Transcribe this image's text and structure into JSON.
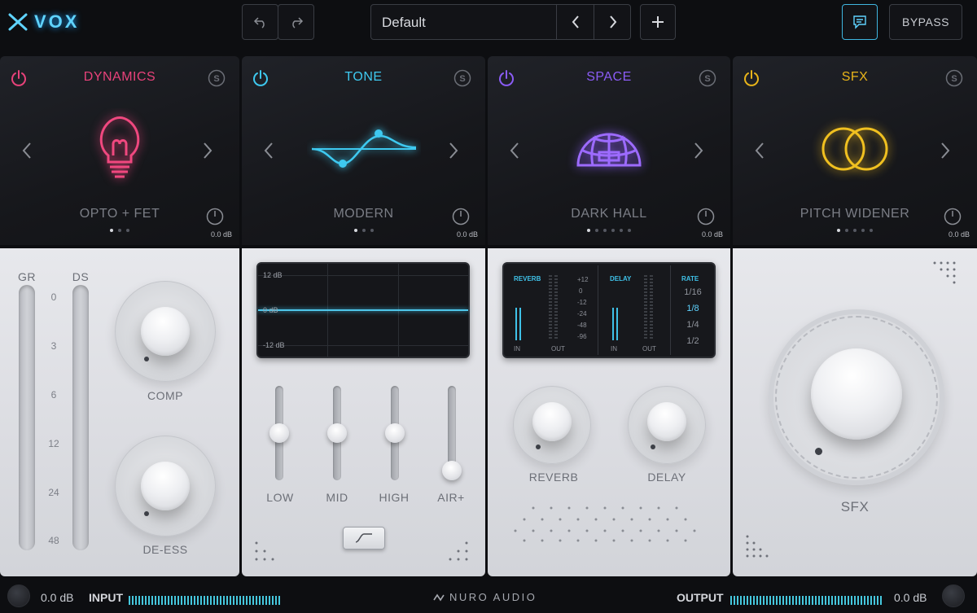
{
  "app": {
    "logo": "VOX",
    "brand": "NURO AUDIO"
  },
  "toolbar": {
    "undo_icon": "undo-icon",
    "redo_icon": "redo-icon",
    "preset_name": "Default",
    "add_icon": "plus-icon",
    "chat_icon": "chat-icon",
    "bypass_label": "BYPASS"
  },
  "modules": [
    {
      "title": "DYNAMICS",
      "color": "#e8427a",
      "preset": "OPTO + FET",
      "gain": "0.0 dB",
      "icon": "lightbulb-icon"
    },
    {
      "title": "TONE",
      "color": "#3ec9f0",
      "preset": "MODERN",
      "gain": "0.0 dB",
      "icon": "eq-curve-icon"
    },
    {
      "title": "SPACE",
      "color": "#8b5cf6",
      "preset": "DARK HALL",
      "gain": "0.0 dB",
      "icon": "dome-icon"
    },
    {
      "title": "SFX",
      "color": "#e8b41a",
      "preset": "PITCH WIDENER",
      "gain": "0.0 dB",
      "icon": "rings-icon"
    }
  ],
  "dynamics": {
    "gr_label": "GR",
    "ds_label": "DS",
    "scale": [
      "0",
      "3",
      "6",
      "12",
      "24",
      "48"
    ],
    "comp_label": "COMP",
    "deess_label": "DE-ESS"
  },
  "tone": {
    "eq_top": "12 dB",
    "eq_mid": "0 dB",
    "eq_bottom": "-12 dB",
    "bands": [
      "LOW",
      "MID",
      "HIGH",
      "AIR+"
    ],
    "band_levels": [
      0.5,
      0.5,
      0.5,
      0.0
    ]
  },
  "space": {
    "reverb_hd": "REVERB",
    "delay_hd": "DELAY",
    "rate_hd": "RATE",
    "db_scale": [
      "+12",
      "0",
      "-12",
      "-24",
      "-48",
      "-96"
    ],
    "in_label": "IN",
    "out_label": "OUT",
    "rates": [
      "1/16",
      "1/8",
      "1/4",
      "1/2"
    ],
    "selected_rate": "1/8",
    "reverb_label": "REVERB",
    "delay_label": "DELAY"
  },
  "sfx": {
    "label": "SFX"
  },
  "footer": {
    "input_db": "0.0 dB",
    "input_label": "INPUT",
    "output_label": "OUTPUT",
    "output_db": "0.0 dB"
  }
}
